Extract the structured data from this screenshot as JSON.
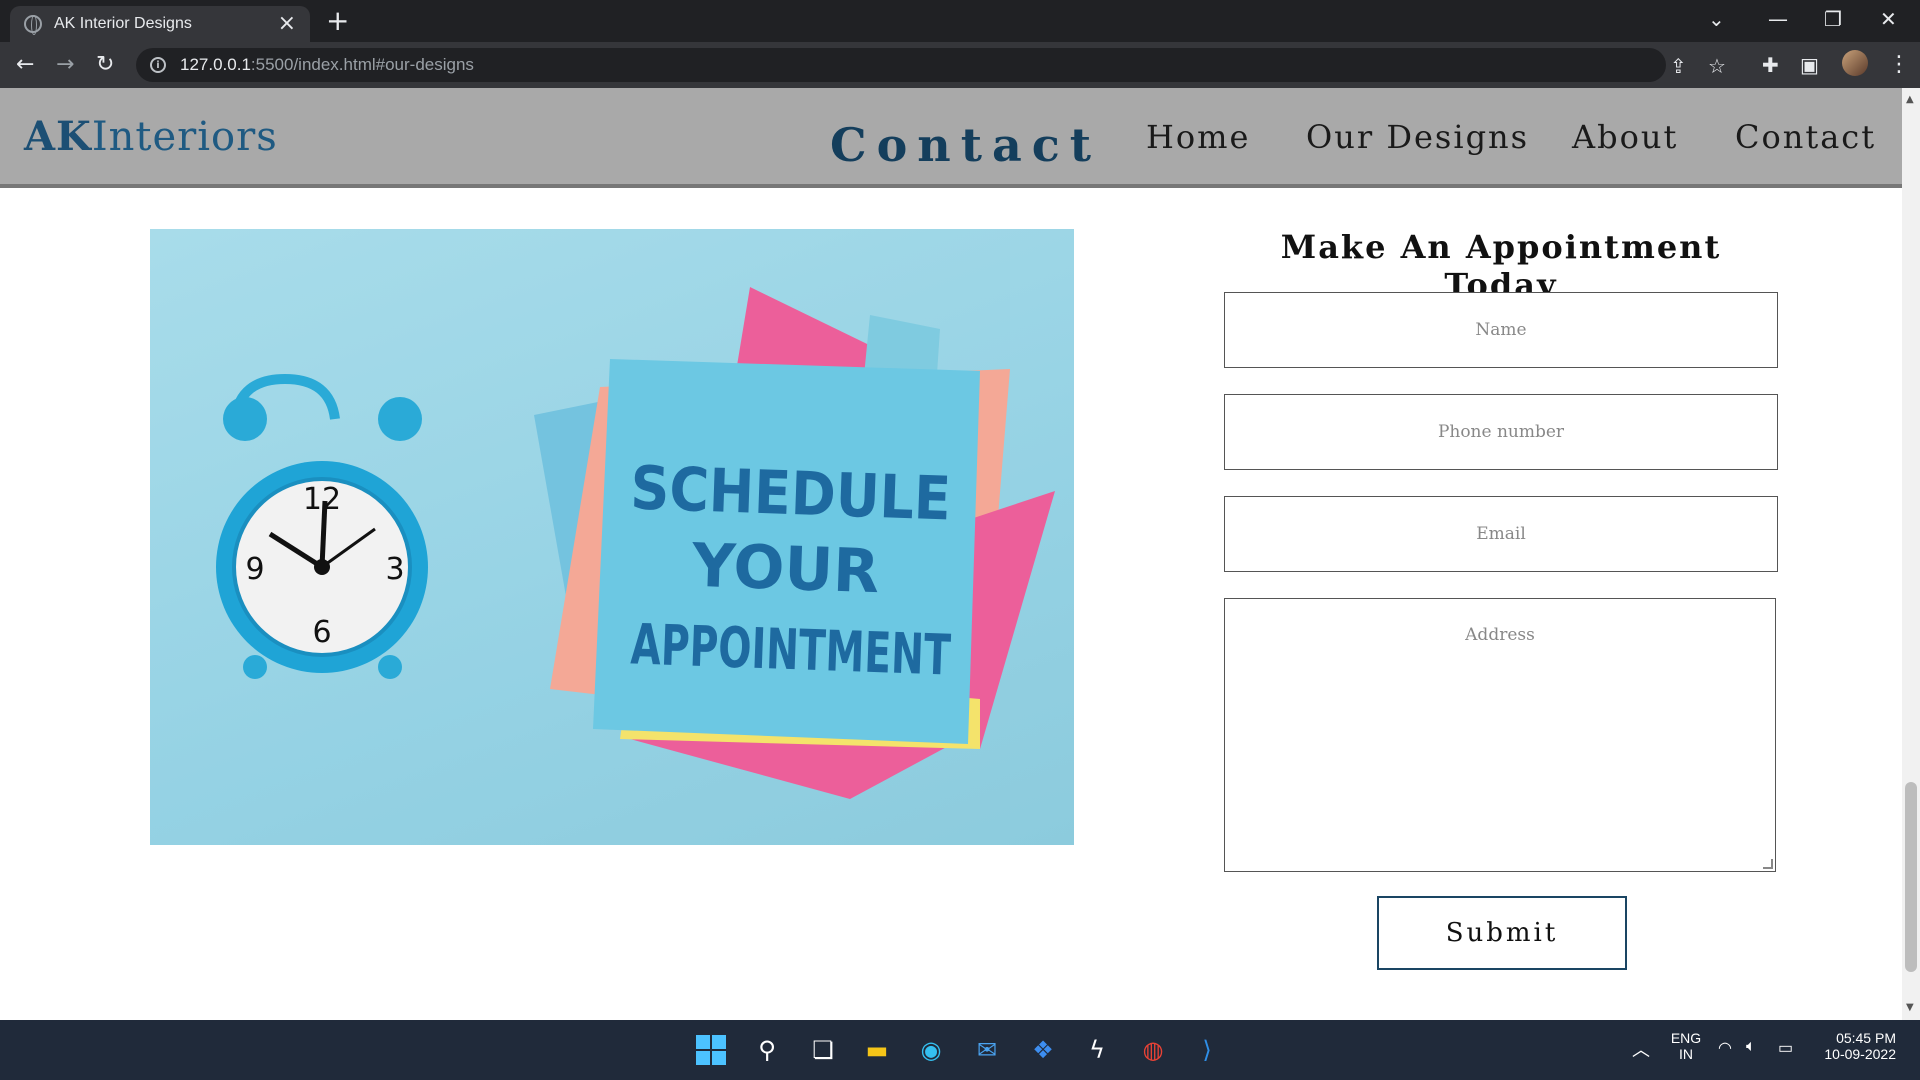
{
  "browser": {
    "tab_title": "AK Interior Designs",
    "url_host": "127.0.0.1",
    "url_rest": ":5500/index.html#our-designs"
  },
  "site": {
    "logo_bold": "AK",
    "logo_rest": "Interiors",
    "section_title": "Contact",
    "nav": [
      "Home",
      "Our Designs",
      "About",
      "Contact"
    ]
  },
  "image": {
    "note_lines": [
      "SCHEDULE",
      "YOUR",
      "APPOINTMENT"
    ]
  },
  "form": {
    "title": "Make An Appointment Today",
    "name_placeholder": "Name",
    "phone_placeholder": "Phone number",
    "email_placeholder": "Email",
    "address_placeholder": "Address",
    "submit_label": "Submit"
  },
  "system": {
    "lang_top": "ENG",
    "lang_bottom": "IN",
    "time": "05:45 PM",
    "date": "10-09-2022"
  },
  "colors": {
    "header_bg": "#a9a9a9",
    "brand": "#1f5a82",
    "taskbar": "#202a3a"
  }
}
